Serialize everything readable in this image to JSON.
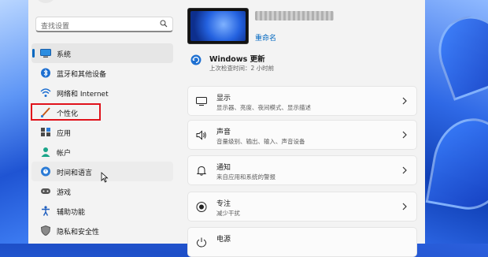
{
  "sidebar": {
    "search_placeholder": "查找设置",
    "items": [
      {
        "label": "系统",
        "icon": "system-icon",
        "active": true
      },
      {
        "label": "蓝牙和其他设备",
        "icon": "bluetooth-icon"
      },
      {
        "label": "网络和 Internet",
        "icon": "wifi-icon"
      },
      {
        "label": "个性化",
        "icon": "brush-icon",
        "highlighted": true
      },
      {
        "label": "应用",
        "icon": "apps-icon"
      },
      {
        "label": "帐户",
        "icon": "account-icon"
      },
      {
        "label": "时间和语言",
        "icon": "globe-clock-icon",
        "hover": true
      },
      {
        "label": "游戏",
        "icon": "gamepad-icon"
      },
      {
        "label": "辅助功能",
        "icon": "accessibility-icon"
      },
      {
        "label": "隐私和安全性",
        "icon": "shield-icon"
      }
    ]
  },
  "device": {
    "rename_label": "重命名"
  },
  "update": {
    "title": "Windows 更新",
    "subtitle": "上次检查时间：2 小时前"
  },
  "cards": [
    {
      "title": "显示",
      "subtitle": "显示器、亮度、夜间模式、显示描述",
      "icon": "display-icon"
    },
    {
      "title": "声音",
      "subtitle": "音量级别、输出、输入、声音设备",
      "icon": "speaker-icon"
    },
    {
      "title": "通知",
      "subtitle": "来自应用和系统的警报",
      "icon": "bell-icon"
    },
    {
      "title": "专注",
      "subtitle": "减少干扰",
      "icon": "focus-icon"
    },
    {
      "title": "电源",
      "subtitle": "",
      "icon": "power-icon"
    }
  ],
  "colors": {
    "accent": "#0067c0",
    "highlight_box": "#e0121b",
    "window_bg": "#f3f3f3"
  }
}
